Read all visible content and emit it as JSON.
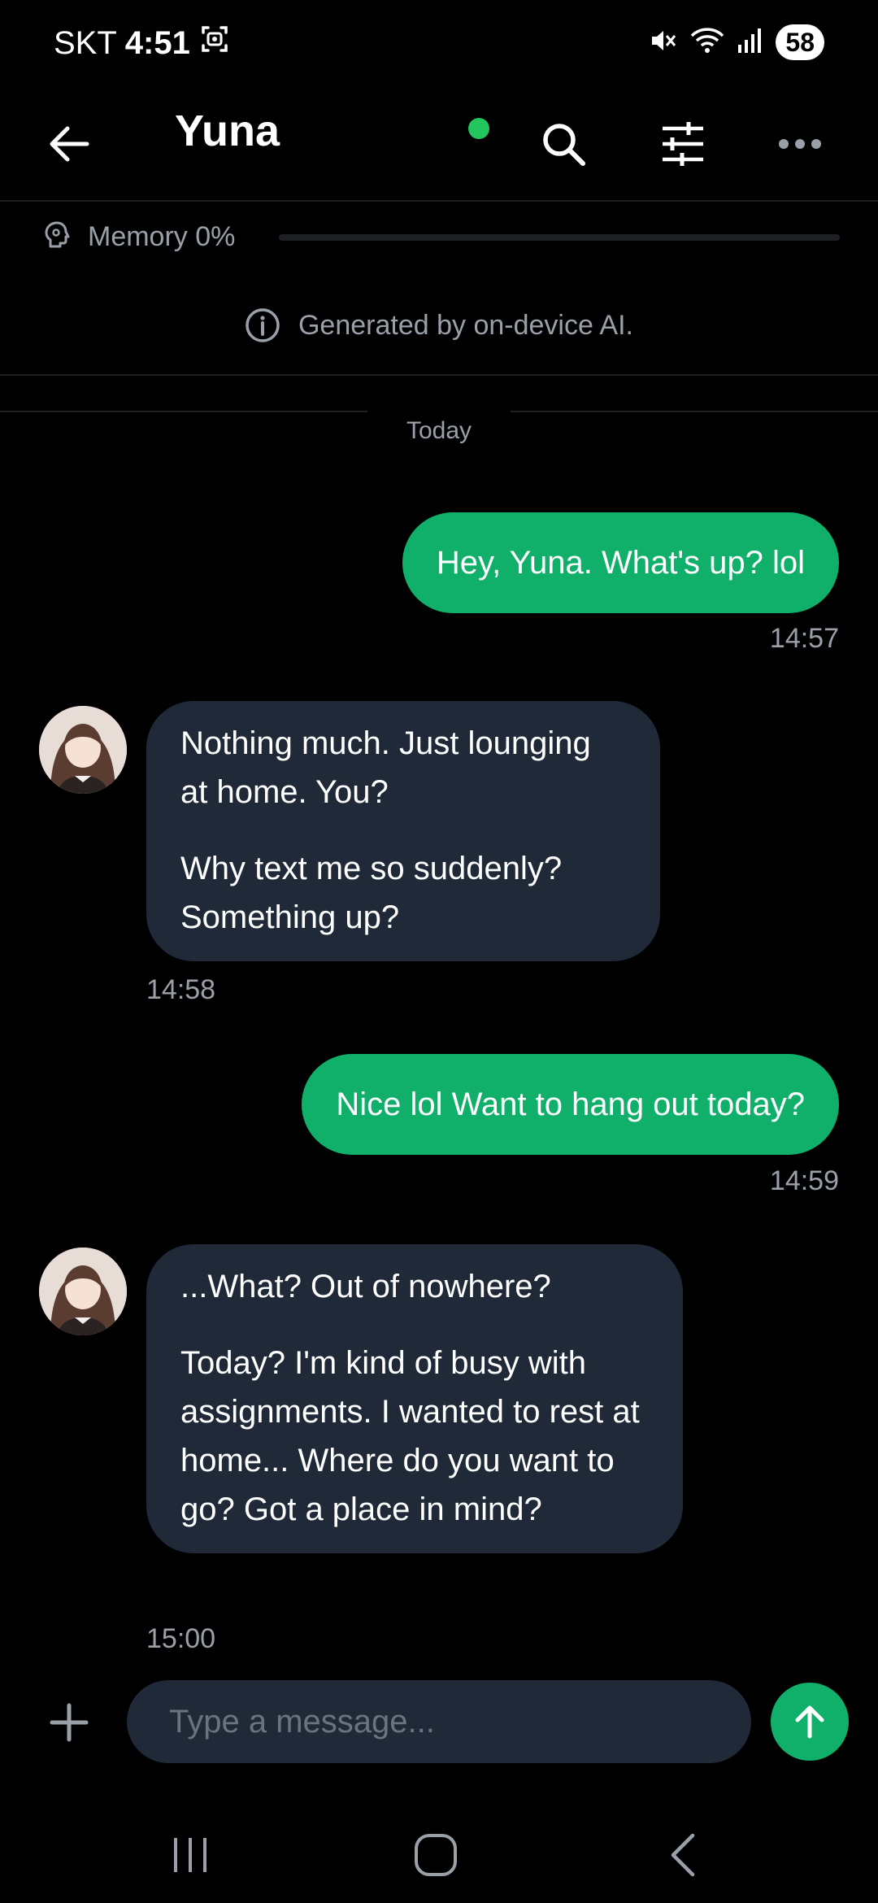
{
  "status_bar": {
    "carrier": "SKT",
    "time": "4:51",
    "battery": "58",
    "icons": [
      "screenshot-icon",
      "mute-icon",
      "wifi-icon",
      "signal-icon",
      "battery-icon"
    ]
  },
  "header": {
    "title": "Yuna",
    "online": true,
    "icons": [
      "back-arrow-icon",
      "search-icon",
      "sliders-icon",
      "more-dots-icon"
    ]
  },
  "memory": {
    "label": "Memory 0%",
    "level": 0
  },
  "notice": {
    "text": "Generated by on-device AI."
  },
  "date_separator": "Today",
  "messages": [
    {
      "sender": "user",
      "paragraphs": [
        "Hey, Yuna. What's up? lol"
      ],
      "time": "14:57"
    },
    {
      "sender": "bot",
      "paragraphs": [
        "Nothing much. Just lounging at home. You?",
        "Why text me so suddenly? Something up?"
      ],
      "time": "14:58"
    },
    {
      "sender": "user",
      "paragraphs": [
        "Nice lol Want to hang out today?"
      ],
      "time": "14:59"
    },
    {
      "sender": "bot",
      "paragraphs": [
        "...What? Out of nowhere?",
        "Today? I'm kind of busy with assignments. I wanted to rest at home... Where do you want to go? Got a place in mind?"
      ],
      "time": "15:00"
    }
  ],
  "composer": {
    "placeholder": "Type a message...",
    "value": ""
  },
  "colors": {
    "accent": "#10b06a",
    "online": "#22c55e",
    "bubble_in": "#1f2937",
    "background": "#000000",
    "muted_text": "#9aa0a8"
  }
}
